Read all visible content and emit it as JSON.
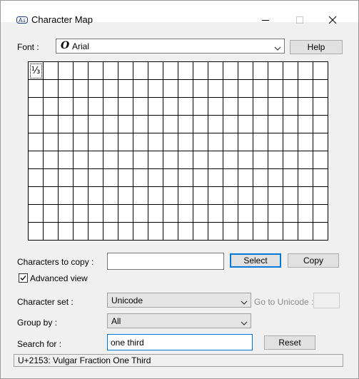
{
  "window": {
    "title": "Character Map"
  },
  "font": {
    "label": "Font :",
    "selected": "Arial",
    "type_glyph": "O",
    "help_label": "Help"
  },
  "grid": {
    "selected_char": "⅓",
    "columns": 20,
    "rows": 10
  },
  "copy_area": {
    "label": "Characters to copy :",
    "value": "",
    "select_label": "Select",
    "copy_label": "Copy"
  },
  "advanced": {
    "label": "Advanced view",
    "checked": true
  },
  "character_set": {
    "label": "Character set :",
    "selected": "Unicode",
    "goto_label": "Go to Unicode :",
    "goto_value": ""
  },
  "group_by": {
    "label": "Group by :",
    "selected": "All"
  },
  "search": {
    "label": "Search for :",
    "value": "one third",
    "reset_label": "Reset"
  },
  "status": {
    "text": "U+2153: Vulgar Fraction One Third"
  },
  "colors": {
    "accent": "#0078d7",
    "window_bg": "#f0f0f0"
  }
}
